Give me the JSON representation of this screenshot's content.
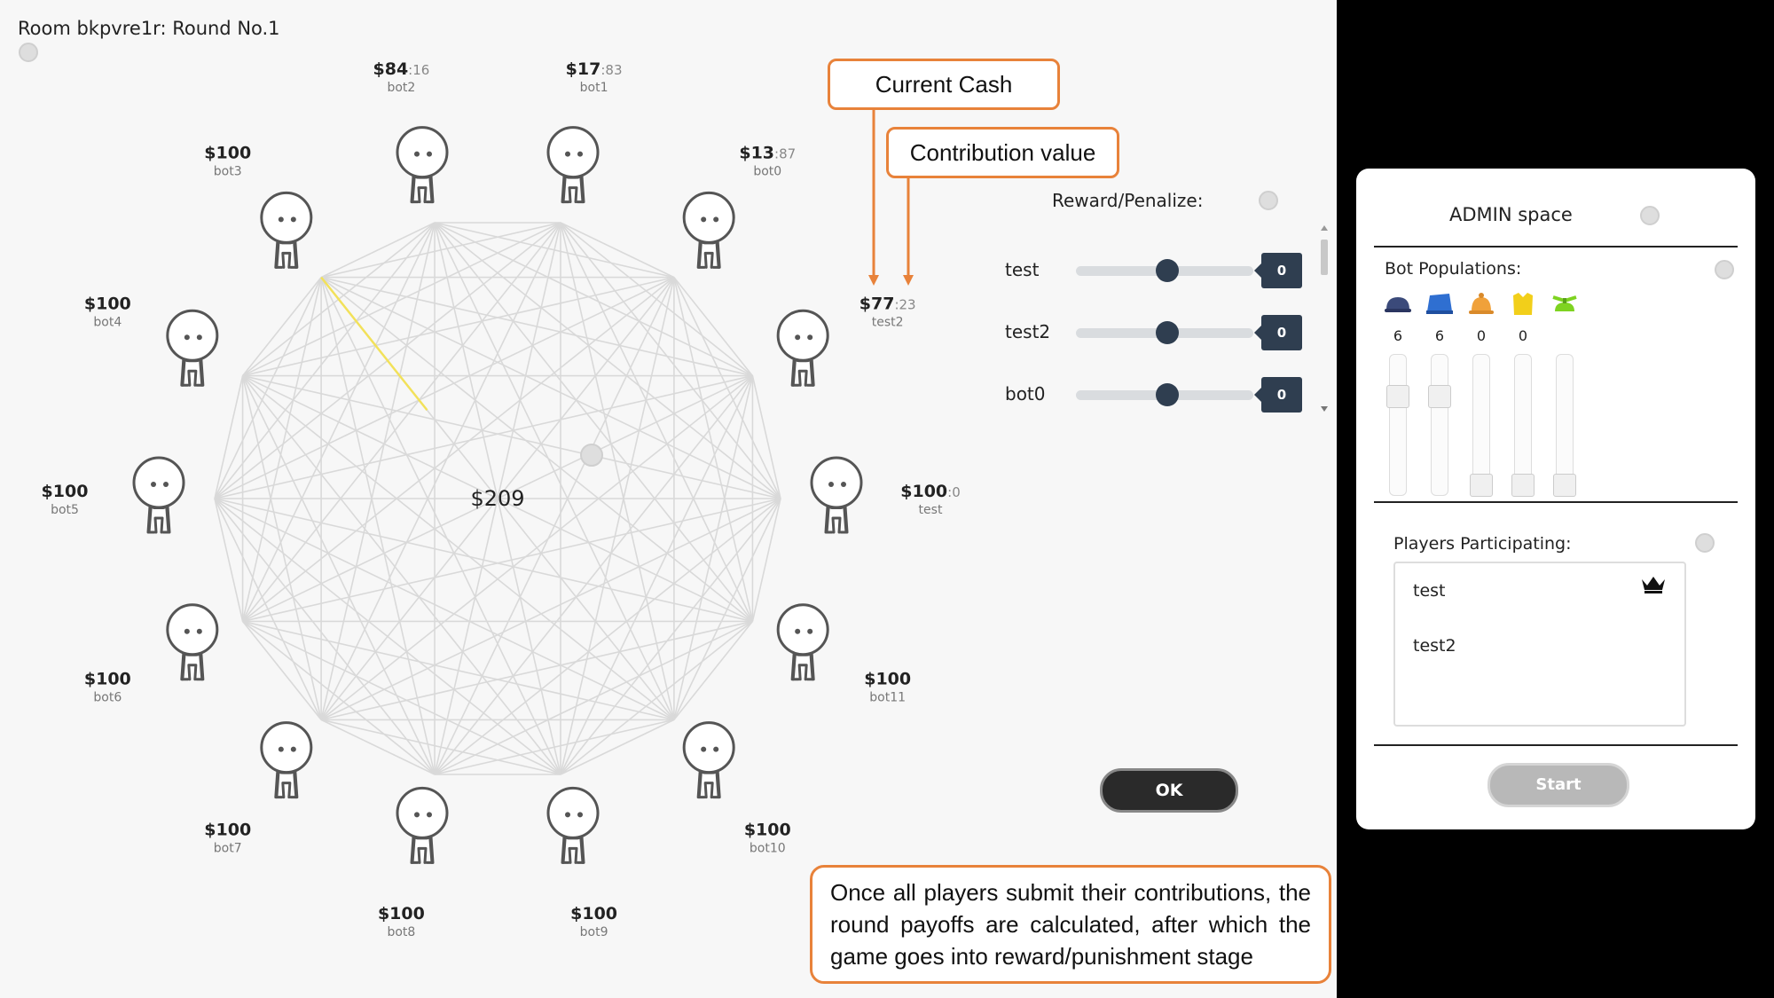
{
  "room_title": "Room bkpvre1r: Round No.1",
  "pot": "$209",
  "players": [
    {
      "name": "test",
      "cash": "$100",
      "contribution": ":0"
    },
    {
      "name": "test2",
      "cash": "$77",
      "contribution": ":23"
    },
    {
      "name": "bot0",
      "cash": "$13",
      "contribution": ":87"
    },
    {
      "name": "bot1",
      "cash": "$17",
      "contribution": ":83"
    },
    {
      "name": "bot2",
      "cash": "$84",
      "contribution": ":16"
    },
    {
      "name": "bot3",
      "cash": "$100",
      "contribution": ""
    },
    {
      "name": "bot4",
      "cash": "$100",
      "contribution": ""
    },
    {
      "name": "bot5",
      "cash": "$100",
      "contribution": ""
    },
    {
      "name": "bot6",
      "cash": "$100",
      "contribution": ""
    },
    {
      "name": "bot7",
      "cash": "$100",
      "contribution": ""
    },
    {
      "name": "bot8",
      "cash": "$100",
      "contribution": ""
    },
    {
      "name": "bot9",
      "cash": "$100",
      "contribution": ""
    },
    {
      "name": "bot10",
      "cash": "$100",
      "contribution": ""
    },
    {
      "name": "bot11",
      "cash": "$100",
      "contribution": ""
    }
  ],
  "reward_penalize": {
    "title": "Reward/Penalize:",
    "rows": [
      {
        "name": "test",
        "value": "0"
      },
      {
        "name": "test2",
        "value": "0"
      },
      {
        "name": "bot0",
        "value": "0"
      }
    ]
  },
  "ok_label": "OK",
  "annotations": {
    "current_cash": "Current Cash",
    "contribution_value": "Contribution value",
    "note": "Once all players submit their contributions, the round payoffs are calculated, after which the game goes into reward/punishment stage",
    "color": "#e8823a"
  },
  "admin": {
    "title": "ADMIN space",
    "bot_populations_label": "Bot Populations:",
    "bots": [
      {
        "icon": "navy-hat-icon",
        "color": "#3b4a7a",
        "count": "6",
        "level": 0.75
      },
      {
        "icon": "blue-box-hat-icon",
        "color": "#2f6fd1",
        "count": "6",
        "level": 0.75
      },
      {
        "icon": "bell-icon",
        "color": "#f0a13a",
        "count": "0",
        "level": 0.0
      },
      {
        "icon": "yellow-shirt-icon",
        "color": "#f2cf1a",
        "count": "0",
        "level": 0.0
      },
      {
        "icon": "propeller-hat-icon",
        "color": "#7ed321",
        "count": "",
        "level": 0.0
      }
    ],
    "players_label": "Players Participating:",
    "players": [
      "test",
      "test2"
    ],
    "host_icon": "crown-icon",
    "start_label": "Start"
  },
  "colors": {
    "slider_dark": "#2f3e50",
    "highlight_edge": "#f2e15a",
    "panel_bg": "#ffffff"
  }
}
